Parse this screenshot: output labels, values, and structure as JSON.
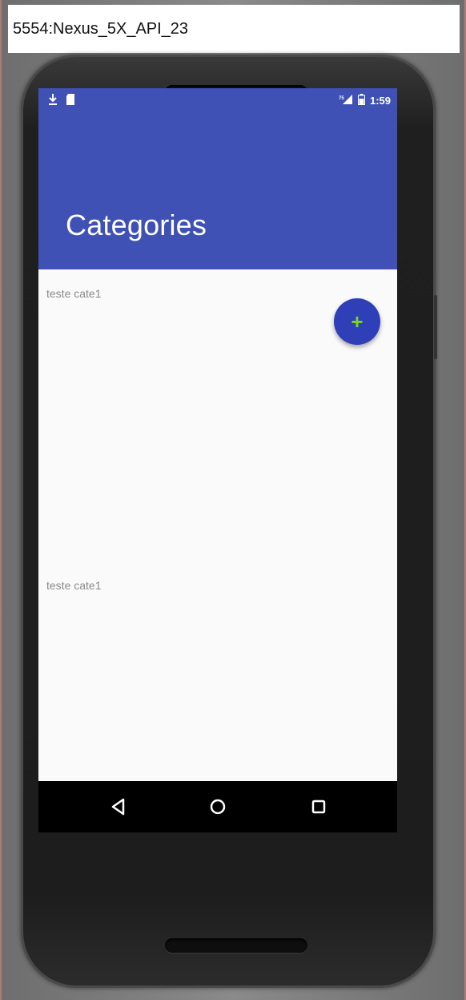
{
  "window": {
    "title": "5554:Nexus_5X_API_23"
  },
  "statusbar": {
    "left_icons": [
      "download-icon",
      "sd-card-icon"
    ],
    "signal_label": "₇₅",
    "time": "1:59"
  },
  "appbar": {
    "title": "Categories",
    "color": "#3f51b5"
  },
  "fab": {
    "label": "+",
    "icon": "add-icon",
    "color": "#2e3fb8"
  },
  "list": {
    "items": [
      {
        "label": "teste cate1"
      },
      {
        "label": "teste cate1"
      }
    ]
  },
  "navbar": {
    "buttons": [
      "back-icon",
      "home-icon",
      "recents-icon"
    ]
  }
}
